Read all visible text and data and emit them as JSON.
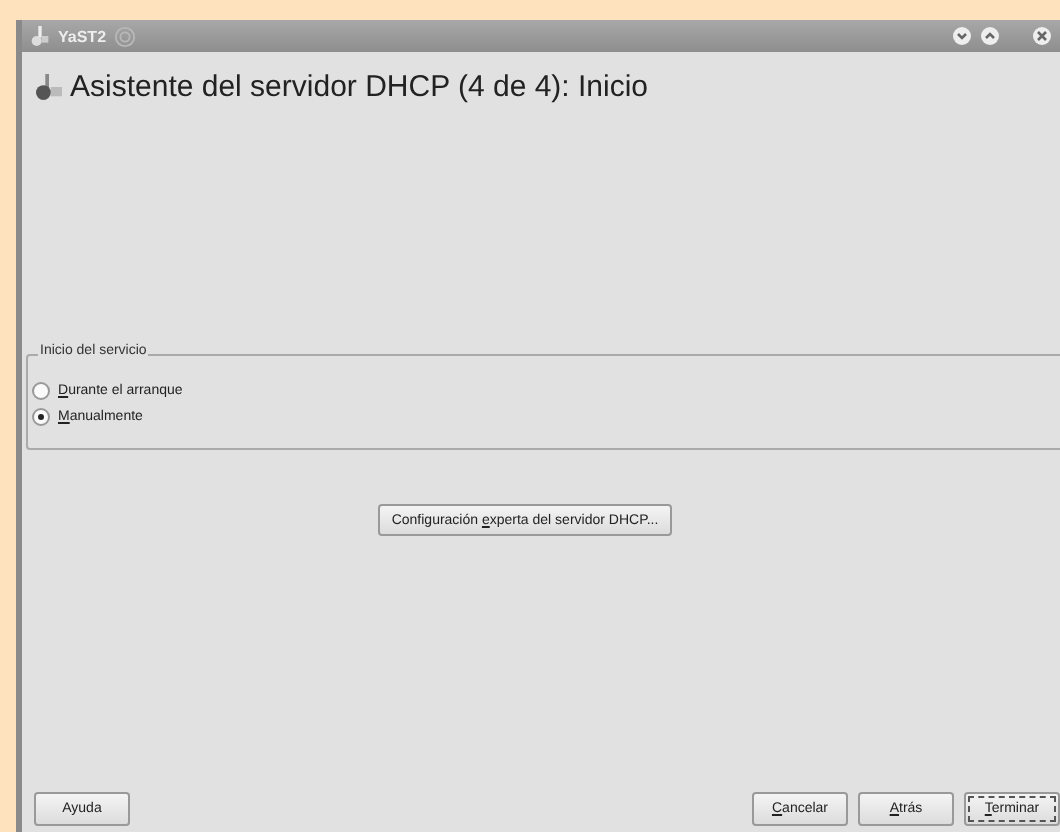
{
  "window": {
    "title": "YaST2"
  },
  "heading": "Asistente del servidor DHCP (4 de 4): Inicio",
  "service_group": {
    "title": "Inicio del servicio",
    "options": [
      {
        "accel": "D",
        "text_after": "urante el arranque",
        "selected": false
      },
      {
        "accel": "M",
        "text_after": "anualmente",
        "selected": true
      }
    ]
  },
  "expert_button": {
    "text_before": "Configuración ",
    "accel": "e",
    "text_after": "xperta del servidor DHCP..."
  },
  "buttons": [
    {
      "text_after": "Ayuda",
      "kind": "left",
      "default": false
    },
    {
      "accel": "C",
      "text_after": "ancelar",
      "kind": "right",
      "default": false
    },
    {
      "accel": "A",
      "text_after": "trás",
      "kind": "right",
      "default": false
    },
    {
      "accel": "T",
      "text_after": "erminar",
      "kind": "right",
      "default": true
    }
  ]
}
